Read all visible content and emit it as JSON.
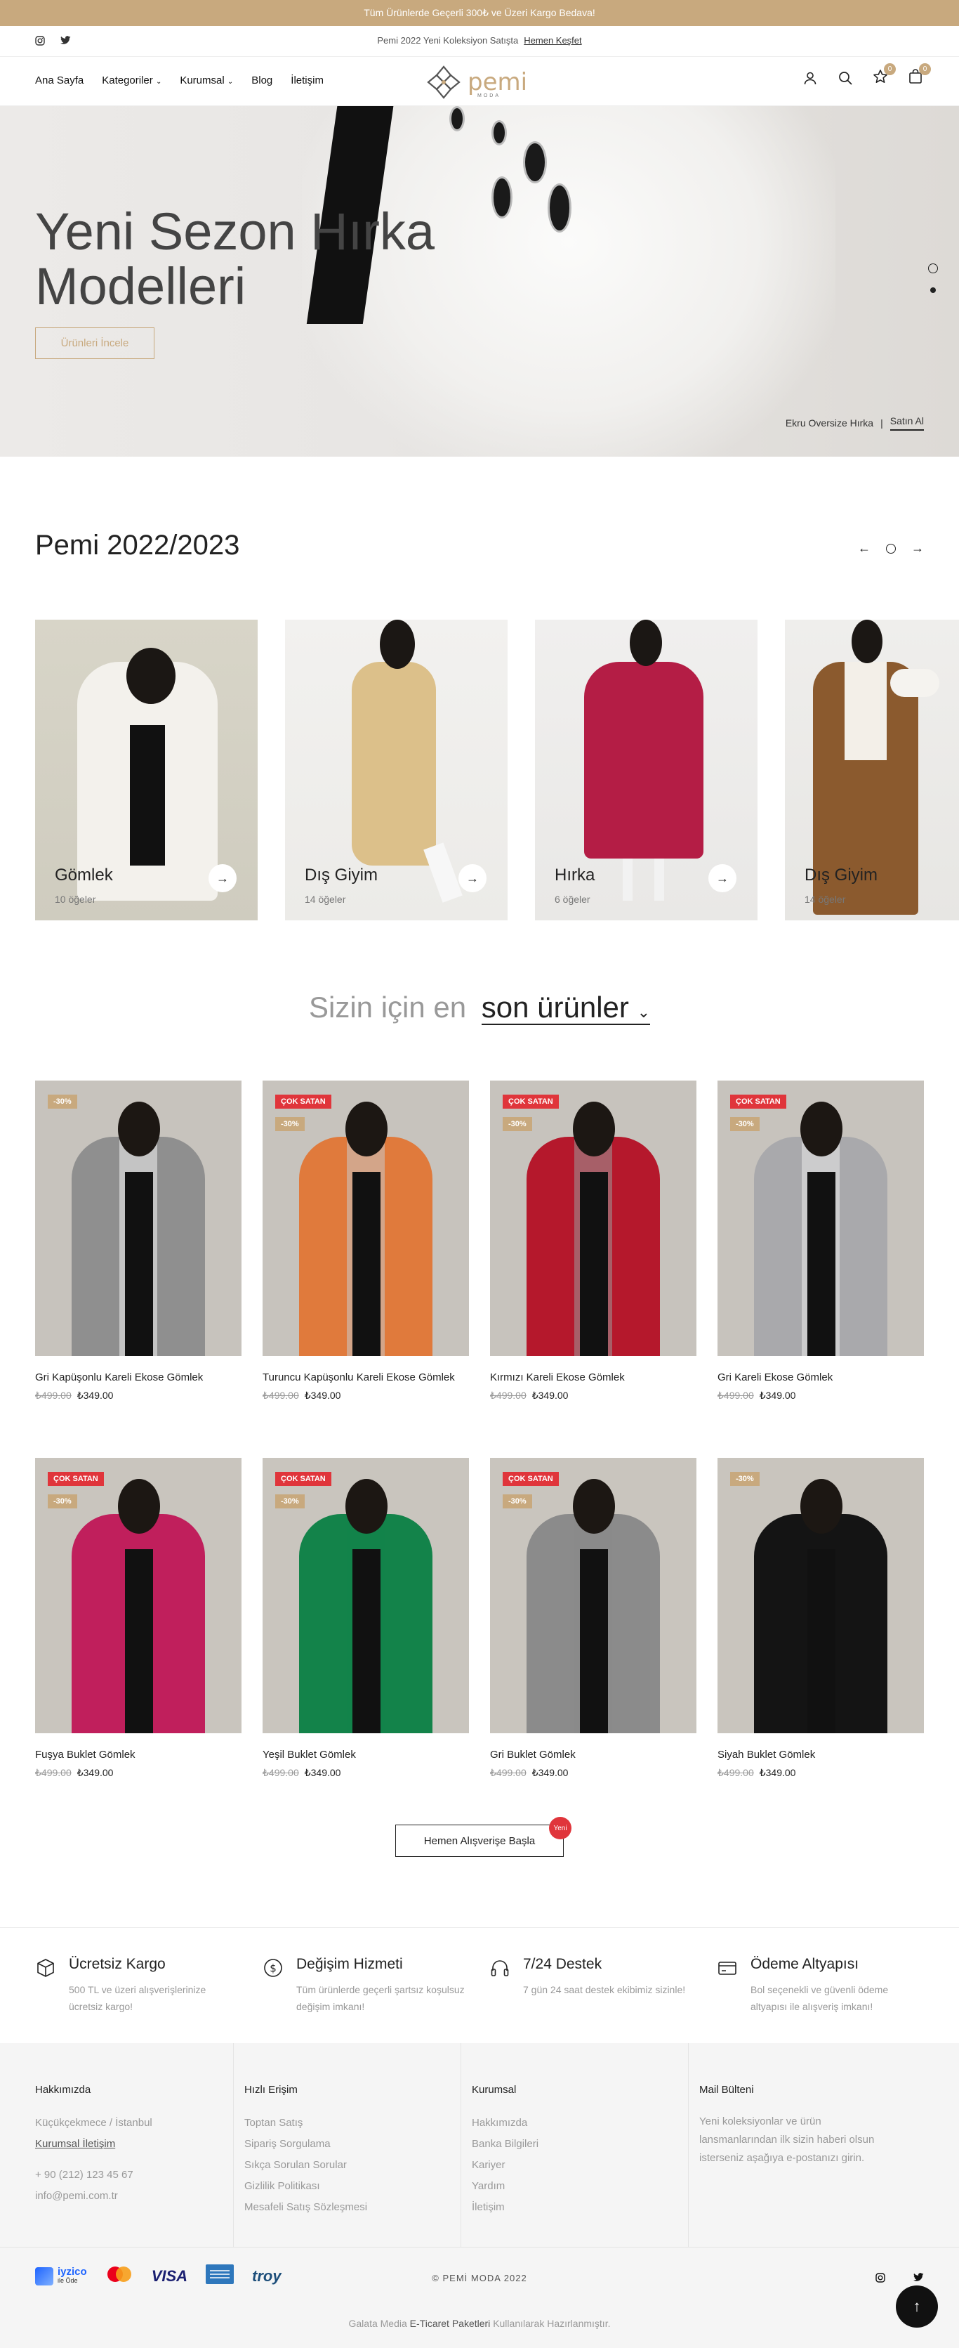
{
  "topbar": {
    "text": "Tüm Ürünlerde Geçerli 300₺ ve Üzeri Kargo Bedava!"
  },
  "subbar": {
    "promo": "Pemi 2022 Yeni Koleksiyon Satışta",
    "link": "Hemen Keşfet"
  },
  "nav": {
    "items": [
      "Ana Sayfa",
      "Kategoriler",
      "Kurumsal",
      "Blog",
      "İletişim"
    ],
    "logo_text": "pemi",
    "logo_sub": "MODA",
    "wishlist_count": "0",
    "cart_count": "0"
  },
  "hero": {
    "title": "Yeni Sezon Hırka Modelleri",
    "button": "Ürünleri İncele",
    "caption": "Ekru Oversize Hırka",
    "caption_link": "Satın Al"
  },
  "collection": {
    "title": "Pemi 2022/2023",
    "categories": [
      {
        "name": "Gömlek",
        "count": "10 öğeler"
      },
      {
        "name": "Dış Giyim",
        "count": "14 öğeler"
      },
      {
        "name": "Hırka",
        "count": "6 öğeler"
      },
      {
        "name": "Dış Giyim",
        "count": "14 öğeler"
      }
    ]
  },
  "latest": {
    "prefix": "Sizin için en",
    "selected": "son ürünler"
  },
  "badges": {
    "hot": "ÇOK SATAN",
    "new": "Yeni"
  },
  "products": [
    {
      "name": "Gri Kapüşonlu Kareli Ekose Gömlek",
      "old": "₺499.00",
      "price": "₺349.00",
      "discount": "-30%",
      "hot": false
    },
    {
      "name": "Turuncu Kapüşonlu Kareli Ekose Gömlek",
      "old": "₺499.00",
      "price": "₺349.00",
      "discount": "-30%",
      "hot": true
    },
    {
      "name": "Kırmızı Kareli Ekose Gömlek",
      "old": "₺499.00",
      "price": "₺349.00",
      "discount": "-30%",
      "hot": true
    },
    {
      "name": "Gri Kareli Ekose Gömlek",
      "old": "₺499.00",
      "price": "₺349.00",
      "discount": "-30%",
      "hot": true
    },
    {
      "name": "Fuşya Buklet Gömlek",
      "old": "₺499.00",
      "price": "₺349.00",
      "discount": "-30%",
      "hot": true
    },
    {
      "name": "Yeşil Buklet Gömlek",
      "old": "₺499.00",
      "price": "₺349.00",
      "discount": "-30%",
      "hot": true
    },
    {
      "name": "Gri Buklet Gömlek",
      "old": "₺499.00",
      "price": "₺349.00",
      "discount": "-30%",
      "hot": true
    },
    {
      "name": "Siyah Buklet Gömlek",
      "old": "₺499.00",
      "price": "₺349.00",
      "discount": "-30%",
      "hot": false
    }
  ],
  "cta": {
    "label": "Hemen Alışverişe Başla"
  },
  "features": [
    {
      "title": "Ücretsiz Kargo",
      "text": "500 TL ve üzeri alışverişlerinize ücretsiz kargo!"
    },
    {
      "title": "Değişim Hizmeti",
      "text": "Tüm ürünlerde geçerli şartsız koşulsuz değişim imkanı!"
    },
    {
      "title": "7/24 Destek",
      "text": "7 gün 24 saat destek ekibimiz sizinle!"
    },
    {
      "title": "Ödeme Altyapısı",
      "text": "Bol seçenekli ve güvenli ödeme altyapısı ile alışveriş imkanı!"
    }
  ],
  "footer": {
    "about": {
      "title": "Hakkımızda",
      "address": "Küçükçekmece / İstanbul",
      "contact_link": "Kurumsal İletişim",
      "phone": "+ 90 (212) 123 45 67",
      "email": "info@pemi.com.tr"
    },
    "quick": {
      "title": "Hızlı Erişim",
      "items": [
        "Toptan Satış",
        "Sipariş Sorgulama",
        "Sıkça Sorulan Sorular",
        "Gizlilik Politikası",
        "Mesafeli Satış Sözleşmesi"
      ]
    },
    "corporate": {
      "title": "Kurumsal",
      "items": [
        "Hakkımızda",
        "Banka Bilgileri",
        "Kariyer",
        "Yardım",
        "İletişim"
      ]
    },
    "newsletter": {
      "title": "Mail Bülteni",
      "text": "Yeni koleksiyonlar ve ürün lansmanlarından ilk sizin haberi olsun isterseniz aşağıya e-postanızı girin."
    }
  },
  "bottom": {
    "payments": [
      "iyzico",
      "ile Öde",
      "VISA",
      "troy"
    ],
    "copyright": "© PEMİ MODA 2022",
    "credit_prefix": "Galata Media",
    "credit_strong": "E-Ticaret Paketleri",
    "credit_suffix": "Kullanılarak Hazırlanmıştır."
  },
  "colors": {
    "accent": "#c8a97e",
    "hot": "#e0353b"
  }
}
